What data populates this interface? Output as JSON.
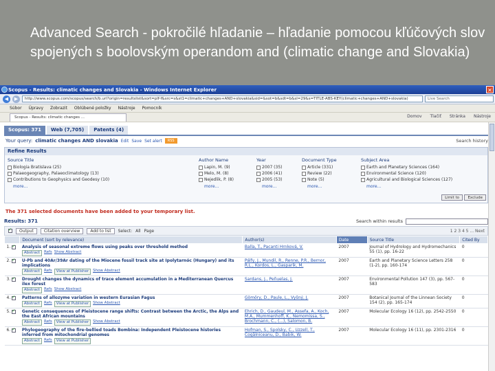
{
  "slide": {
    "title": "Advanced Search   -  pokročilé hľadanie – hľadanie pomocou kľúčových slov spojených s boolovským operandom and (climatic change and Slovakia)"
  },
  "browser": {
    "window_title": "Scopus - Results: climatic changes and Slovakia - Windows Internet Explorer",
    "url": "http://www.scopus.com/scopus/search/b.url?origin=resultslist&sort=plf-f&src=s&st1=climatic+changes+AND+slovakia&sid=&sot=b&sdt=b&sl=29&s=TITLE-ABS-KEY(climatic+changes+AND+slovakia)",
    "search_placeholder": "Live Search",
    "menu": [
      "Súbor",
      "Úpravy",
      "Zobrazit",
      "Oblúbené položky",
      "Nástroje",
      "Pomocník"
    ],
    "tab_label": "Scopus - Results: climatic changes ...",
    "tools": [
      "Domov",
      "Tlačiť",
      "Stránka",
      "Nástroje"
    ]
  },
  "scopus": {
    "tabs": [
      "Scopus: 371",
      "Web (7,705)",
      "Patents (4)"
    ],
    "query_label": "Your query:",
    "query": "climatic changes AND slovakia",
    "query_links": [
      "Edit",
      "Save",
      "Set alert"
    ],
    "rss": "RSS",
    "search_history": "Search history",
    "refine_title": "Refine Results",
    "facets": [
      {
        "head": "Source Title",
        "items": [
          "Biologia Bratislava (25)",
          "Palaeogeography, Palaeoclimatology (13)",
          "Contributions to Geophysics and Geodesy (10)"
        ],
        "more": "more..."
      },
      {
        "head": "Author Name",
        "items": [
          "Lapin, M. (9)",
          "Melo, M. (8)",
          "Nejedlik, P. (8)"
        ],
        "more": "more..."
      },
      {
        "head": "Year",
        "items": [
          "2007 (35)",
          "2006 (41)",
          "2005 (53)"
        ],
        "more": "more..."
      },
      {
        "head": "Document Type",
        "items": [
          "Article (331)",
          "Review (22)",
          "Note (5)"
        ],
        "more": "more..."
      },
      {
        "head": "Subject Area",
        "items": [
          "Earth and Planetary Sciences (164)",
          "Environmental Science (120)",
          "Agricultural and Biological Sciences (127)"
        ],
        "more": "more..."
      }
    ],
    "limit_btn": "Limit to",
    "exclude_btn": "Exclude",
    "notice": "The 371 selected documents have been added to your temporary list.",
    "results_label": "Results: 371",
    "search_within": "Search within results",
    "toolbar": [
      "Output",
      "Citation overview",
      "Add to list",
      "Select:",
      "All",
      "Page"
    ],
    "pager": "1 2 3 4 5 ... Next",
    "columns": [
      "Document (sort by relevance)",
      "Author(s)",
      "Date",
      "Source Title",
      "Cited By"
    ],
    "results": [
      {
        "num": "1.",
        "title": "Analysis of seasonal extreme flows using peaks over threshold method",
        "links": [
          "Abstract",
          "Refs",
          "Show Abstract"
        ],
        "authors": "Balla, T., Pacanti Hrnková, V.",
        "year": "2007",
        "source": "Journal of Hydrology and Hydromechanics 55 (1), pp. 16-22",
        "cited": "0"
      },
      {
        "num": "2.",
        "title": "U-Pb and 40Ar/39Ar dating of the Miocene fossil track site at Ipolytarnóc (Hungary) and its implications",
        "links": [
          "Abstract",
          "Refs",
          "View at Publisher",
          "Show Abstract"
        ],
        "authors": "Pálfy, J., Mundil, R., Renne, P.R., Bernor, R.L., Kordos, L., Gasparik, M.",
        "year": "2007",
        "source": "Earth and Planetary Science Letters 258 (1-2), pp. 160-174",
        "cited": "0"
      },
      {
        "num": "3.",
        "title": "Drought changes the dynamics of trace element accumulation in a Mediterranean Quercus ilex forest",
        "links": [
          "Abstract",
          "Refs",
          "Show Abstract"
        ],
        "authors": "Sardans, J., Peñuelas, J.",
        "year": "2007",
        "source": "Environmental Pollution 147 (3), pp. 567-583",
        "cited": "0"
      },
      {
        "num": "4.",
        "title": "Patterns of allozyme variation in western Eurasian Fagus",
        "links": [
          "Abstract",
          "Refs",
          "View at Publisher",
          "Show Abstract"
        ],
        "authors": "Gömöry, D., Paule, L., Vyšný, J.",
        "year": "2007",
        "source": "Botanical Journal of the Linnean Society 154 (2), pp. 165-174",
        "cited": "0"
      },
      {
        "num": "5.",
        "title": "Genetic consequences of Pleistocene range shifts: Contrast between the Arctic, the Alps and the East African mountains",
        "links": [
          "Abstract",
          "Refs",
          "View at Publisher",
          "Show Abstract"
        ],
        "authors": "Ehrich, D., Gaudeul, M., Assefa, A., Koch, M.A., Mummenhoff, K., Nemomissa, S., Brochmann, C., (...), Salomon, B.",
        "year": "2007",
        "source": "Molecular Ecology 16 (12), pp. 2542-2550",
        "cited": "0"
      },
      {
        "num": "6.",
        "title": "Phylogeography of the fire-bellied toads Bombina: Independent Pleistocene histories inferred from mitochondrial genomes",
        "links": [
          "Abstract",
          "Refs",
          "View at Publisher"
        ],
        "authors": "Hofman, S., Spolsky, C., Uzzell, T., Cogălniceanu, D., Babik, W.",
        "year": "2007",
        "source": "Molecular Ecology 16 (11), pp. 2301-2316",
        "cited": "0"
      }
    ]
  }
}
